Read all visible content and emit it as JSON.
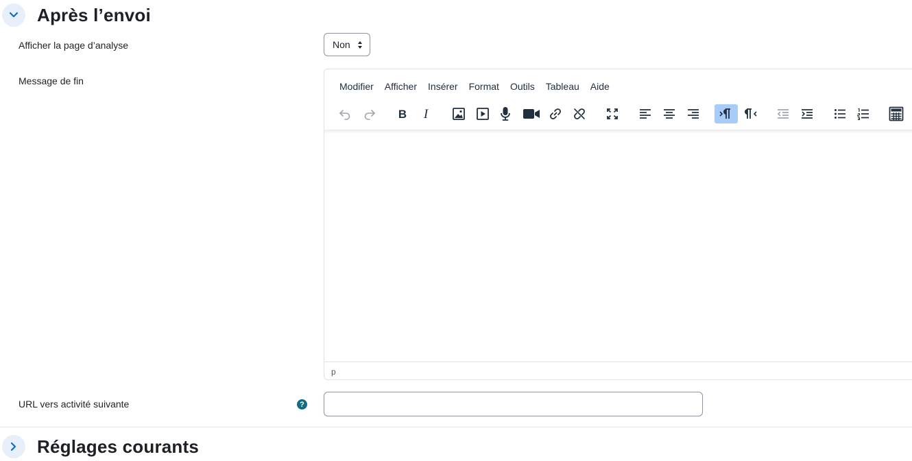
{
  "section_after": {
    "title": "Après l’envoi",
    "expanded": true
  },
  "fields": {
    "show_analysis": {
      "label": "Afficher la page d’analyse",
      "value": "Non"
    },
    "end_message": {
      "label": "Message de fin",
      "statusbar_path": "p"
    },
    "next_activity_url": {
      "label": "URL vers activité suivante",
      "value": "",
      "help_glyph": "?"
    }
  },
  "editor": {
    "menu": [
      "Modifier",
      "Afficher",
      "Insérer",
      "Format",
      "Outils",
      "Tableau",
      "Aide"
    ],
    "toolbar_icons": [
      "undo-icon",
      "redo-icon",
      "bold-icon",
      "italic-icon",
      "image-icon",
      "media-icon",
      "microphone-icon",
      "video-camera-icon",
      "link-icon",
      "unlink-icon",
      "fullscreen-icon",
      "align-left-icon",
      "align-center-icon",
      "align-right-icon",
      "ltr-icon",
      "rtl-icon",
      "outdent-icon",
      "indent-icon",
      "bullet-list-icon",
      "numbered-list-icon",
      "calculator-icon"
    ],
    "active_tool": "ltr-icon"
  },
  "section_common": {
    "title": "Réglages courants",
    "expanded": false
  },
  "colors": {
    "accent": "#0f6cbf",
    "toggle_bg": "#e7f0fa",
    "active_tool_bg": "#a6ccf7",
    "help_icon": "#0f6e84"
  }
}
